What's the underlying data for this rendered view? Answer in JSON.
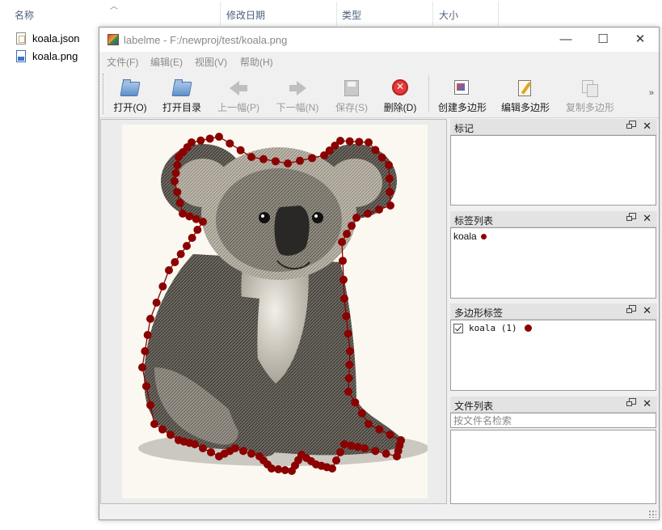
{
  "explorer": {
    "columns": [
      "名称",
      "修改日期",
      "类型",
      "大小"
    ],
    "files": [
      {
        "name": "koala.json",
        "icon": "json-file-icon"
      },
      {
        "name": "koala.png",
        "icon": "png-file-icon"
      }
    ]
  },
  "window": {
    "title": "labelme - F:/newproj/test/koala.png",
    "controls": {
      "minimize": "—",
      "maximize": "☐",
      "close": "✕"
    }
  },
  "menu": [
    "文件(F)",
    "编辑(E)",
    "视图(V)",
    "帮助(H)"
  ],
  "toolbar": {
    "buttons": [
      {
        "label": "打开(O)",
        "icon": "open-folder-icon",
        "enabled": true
      },
      {
        "label": "打开目录",
        "icon": "open-dir-icon",
        "enabled": true
      },
      {
        "label": "上一幅(P)",
        "icon": "prev-arrow-icon",
        "enabled": false
      },
      {
        "label": "下一幅(N)",
        "icon": "next-arrow-icon",
        "enabled": false
      },
      {
        "label": "保存(S)",
        "icon": "save-icon",
        "enabled": false
      },
      {
        "label": "删除(D)",
        "icon": "delete-icon",
        "enabled": true
      },
      {
        "label": "创建多边形",
        "icon": "create-polygon-icon",
        "enabled": true
      },
      {
        "label": "编辑多边形",
        "icon": "edit-polygon-icon",
        "enabled": true
      },
      {
        "label": "复制多边形",
        "icon": "copy-polygon-icon",
        "enabled": false
      }
    ],
    "more": "»"
  },
  "docks": {
    "flags": {
      "title": "标记"
    },
    "label_list": {
      "title": "标签列表",
      "items": [
        {
          "label": "koala",
          "color": "#8b0000"
        }
      ]
    },
    "polygon_labels": {
      "title": "多边形标签",
      "items": [
        {
          "label": "koala (1)",
          "checked": true,
          "color": "#8b0000"
        }
      ]
    },
    "file_list": {
      "title": "文件列表",
      "search_placeholder": "按文件名检索"
    },
    "float_icon": "float-icon",
    "close_glyph": "✕"
  },
  "colors": {
    "annotation": "#8b0000"
  }
}
